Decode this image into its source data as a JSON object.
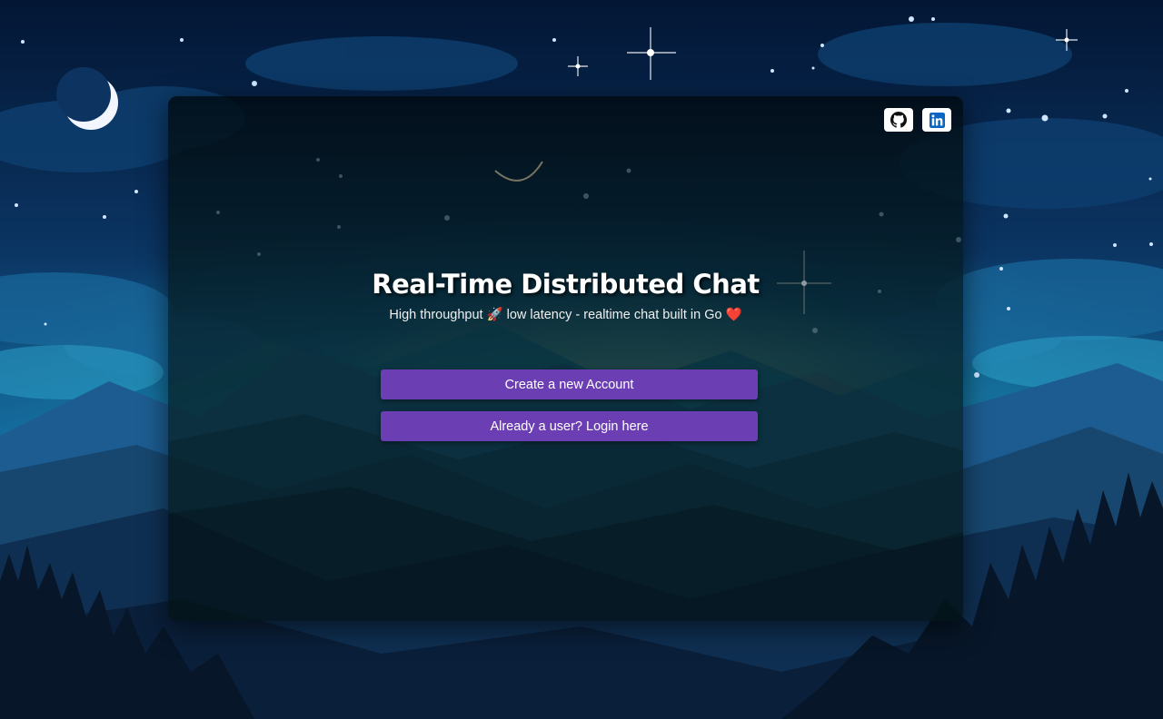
{
  "page": {
    "title": "Real-Time Distributed Chat",
    "subtitle_part1": "High throughput",
    "subtitle_emoji1": "🚀",
    "subtitle_part2": "low latency - realtime chat built in Go",
    "subtitle_emoji2": "❤️"
  },
  "buttons": {
    "create_account": "Create a new Account",
    "login": "Already a user? Login here"
  },
  "social": {
    "github_icon": "github-icon",
    "linkedin_icon": "linkedin-icon"
  },
  "colors": {
    "accent": "#6b3fb3",
    "linkedin": "#0a66c2",
    "background_night": "#0a1f3d"
  }
}
